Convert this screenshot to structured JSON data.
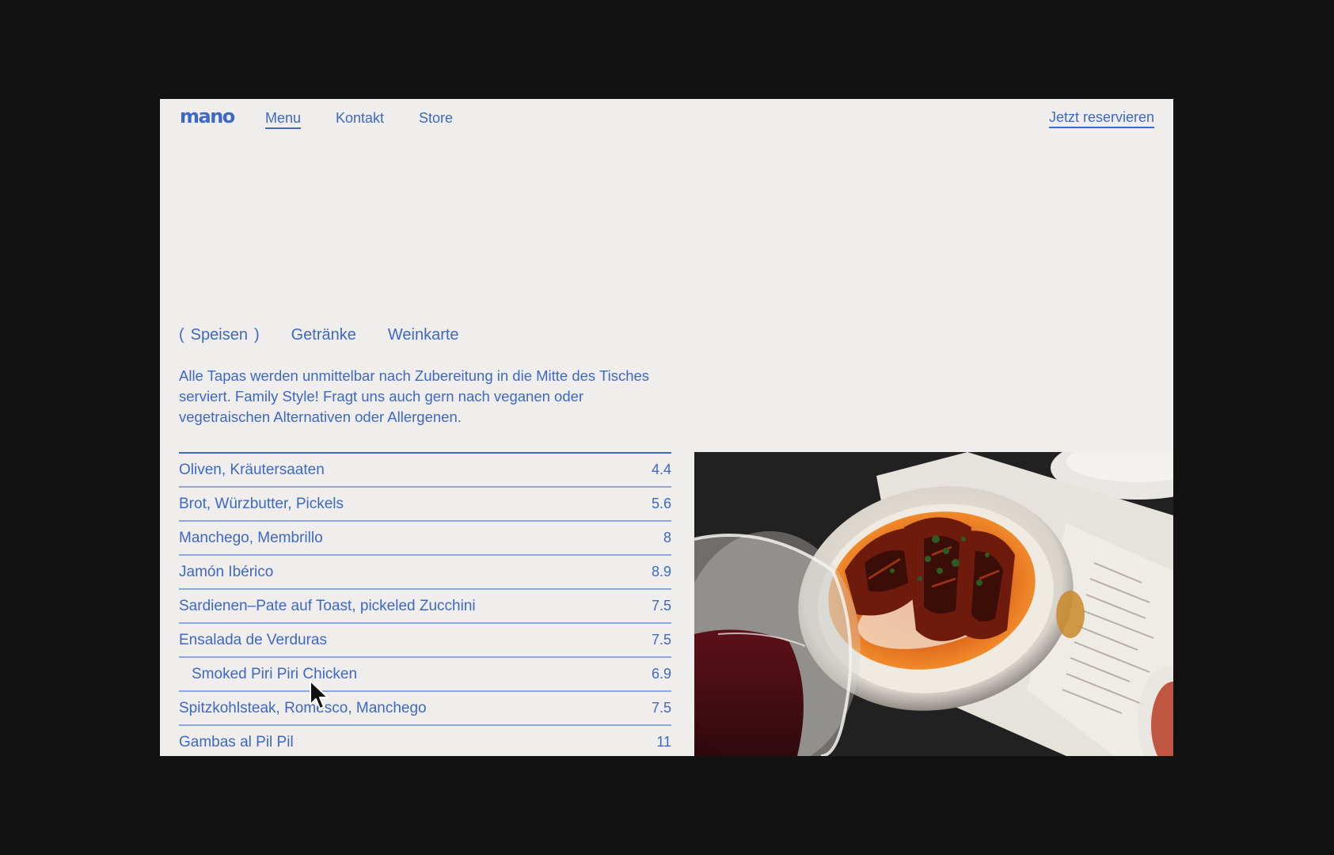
{
  "brand": {
    "logo_text": "mano"
  },
  "nav": {
    "items": [
      {
        "label": "Menu",
        "active": true
      },
      {
        "label": "Kontakt",
        "active": false
      },
      {
        "label": "Store",
        "active": false
      }
    ],
    "cta_label": "Jetzt reservieren"
  },
  "tabs": {
    "items": [
      {
        "label": "Speisen",
        "active": true
      },
      {
        "label": "Getränke",
        "active": false
      },
      {
        "label": "Weinkarte",
        "active": false
      }
    ],
    "active_paren_open": "(",
    "active_paren_close": ")"
  },
  "intro_text": "Alle Tapas werden unmittelbar nach Zubereitung in die Mitte des Tisches serviert. Family Style! Fragt uns auch gern nach veganen oder vegetraischen Alternativen oder Allergenen.",
  "menu_items": [
    {
      "name": "Oliven, Kräutersaaten",
      "price": "4.4"
    },
    {
      "name": "Brot, Würzbutter, Pickels",
      "price": "5.6"
    },
    {
      "name": "Manchego, Membrillo",
      "price": "8"
    },
    {
      "name": "Jamón Ibérico",
      "price": "8.9"
    },
    {
      "name": "Sardienen–Pate auf Toast, pickeled Zucchini",
      "price": "7.5"
    },
    {
      "name": "Ensalada de Verduras",
      "price": "7.5"
    },
    {
      "name": "Smoked Piri Piri Chicken",
      "price": "6.9",
      "hovered": true
    },
    {
      "name": "Spitzkohlsteak, Romesco, Manchego",
      "price": "7.5"
    },
    {
      "name": "Gambas al Pil Pil",
      "price": "11"
    }
  ],
  "colors": {
    "accent": "#3f68c4",
    "background": "#efeeec",
    "outer_background": "#121212"
  },
  "icons": {
    "cursor": "arrow-cursor-icon"
  }
}
